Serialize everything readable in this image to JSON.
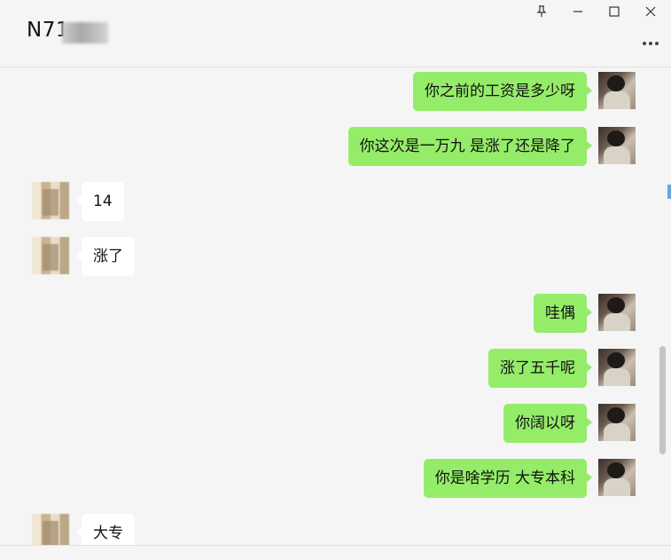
{
  "header": {
    "title": "N71",
    "icons": {
      "pin": "pin-icon",
      "minimize": "minimize-icon",
      "maximize": "maximize-icon",
      "close": "close-icon",
      "more": "more-icon"
    }
  },
  "colors": {
    "background": "#f5f5f5",
    "sent_bubble": "#95ec69",
    "received_bubble": "#ffffff",
    "text": "#111111"
  },
  "messages": [
    {
      "side": "right",
      "text": "你之前的工资是多少呀"
    },
    {
      "side": "right",
      "text": "你这次是一万九 是涨了还是降了"
    },
    {
      "side": "left",
      "text": "14"
    },
    {
      "side": "left",
      "text": "涨了"
    },
    {
      "side": "right",
      "text": "哇偶"
    },
    {
      "side": "right",
      "text": "涨了五千呢"
    },
    {
      "side": "right",
      "text": "你阔以呀"
    },
    {
      "side": "right",
      "text": "你是啥学历  大专本科"
    },
    {
      "side": "left",
      "text": "大专"
    }
  ]
}
